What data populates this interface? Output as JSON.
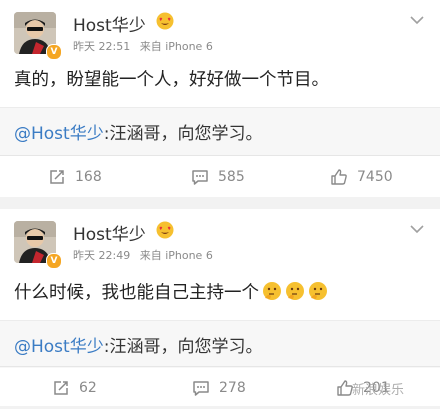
{
  "posts": [
    {
      "username": "Host华少",
      "time": "昨天 22:51",
      "source": "来自 iPhone 6",
      "content": "真的，盼望能一个人，好好做一个节目。",
      "repost_mention": "@Host华少",
      "repost_text": ":汪涵哥，向您学习。",
      "actions": {
        "repost": "168",
        "comment": "585",
        "like": "7450"
      }
    },
    {
      "username": "Host华少",
      "time": "昨天 22:49",
      "source": "来自 iPhone 6",
      "content": "什么时候，我也能自己主持一个",
      "content_emoji_count": 3,
      "repost_mention": "@Host华少",
      "repost_text": ":汪涵哥，向您学习。",
      "actions": {
        "repost": "62",
        "comment": "278",
        "like": "201"
      }
    }
  ],
  "watermark": "新浪娱乐",
  "icons": {
    "avatar": "avatar-photo",
    "verified": "verified-v-icon",
    "member": "heart-eyes-emoji-icon",
    "more": "chevron-down-icon",
    "repost": "repost-icon",
    "comment": "comment-icon",
    "like": "like-thumb-icon",
    "content_emoji": "thinking-emoji-icon"
  },
  "colors": {
    "mention": "#3b7cc4",
    "badge": "#f5a623",
    "text": "#222222",
    "meta": "#8a8a8a"
  }
}
